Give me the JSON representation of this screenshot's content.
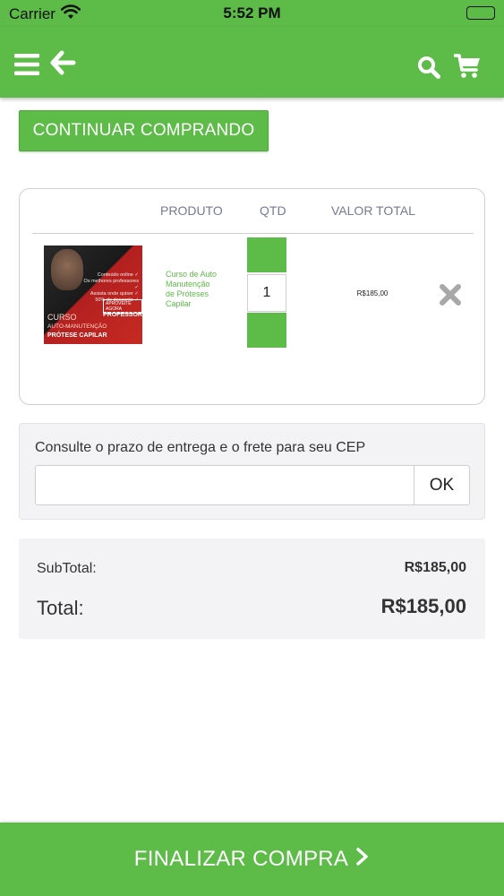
{
  "status_bar": {
    "carrier": "Carrier",
    "time": "5:52 PM",
    "icons": [
      "wifi-icon",
      "battery-icon"
    ]
  },
  "nav": {
    "icons": [
      "menu-icon",
      "back-arrow-icon",
      "search-icon",
      "cart-icon"
    ]
  },
  "buttons": {
    "continue_label": "CONTINUAR COMPRANDO",
    "finalize_label": "FINALIZAR COMPRA"
  },
  "cart": {
    "columns": {
      "product": "PRODUTO",
      "qty": "QTD",
      "total": "VALOR TOTAL"
    },
    "items": [
      {
        "name": "Curso de Auto Manutenção de Próteses Capilar",
        "quantity": "1",
        "line_total": "R$185,00",
        "image_text": {
          "list": [
            "Conteúdo online ✓",
            "Os melhores professores ✓",
            "Assista onde quiser ✓",
            "50% de desconto ✓"
          ],
          "badge": "APROVEITE AGORA",
          "badge_prof": "PROFESSOR",
          "title": "CURSO",
          "subtitle": "AUTO-MANUTENÇÃO",
          "subtitle2": "PRÓTESE CAPILAR"
        }
      }
    ]
  },
  "shipping": {
    "label": "Consulte o prazo de entrega e o frete para seu CEP",
    "cep_value": "",
    "ok_label": "OK"
  },
  "totals": {
    "subtotal_label": "SubTotal:",
    "subtotal_value": "R$185,00",
    "total_label": "Total:",
    "total_value": "R$185,00"
  },
  "colors": {
    "brand_green": "#5dbb47",
    "panel_gray": "#f3f3f5",
    "header_text": "#777a90"
  }
}
